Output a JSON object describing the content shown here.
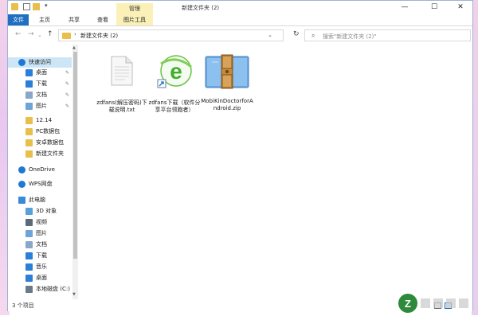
{
  "window": {
    "title": "新建文件夹 (2)"
  },
  "titlebar": {
    "minimize": "—",
    "maximize": "☐",
    "close": "✕",
    "quick_access_arrow": "▾"
  },
  "ribbon": {
    "manage_label": "管理",
    "tabs": [
      "文件",
      "主页",
      "共享",
      "查看",
      "图片工具"
    ]
  },
  "address": {
    "separator": "›",
    "path": "新建文件夹 (2)",
    "search_placeholder": "搜索\"新建文件夹 (2)\""
  },
  "nav_pane": {
    "items": [
      {
        "label": "快速访问",
        "icon": "star-icon",
        "color": "#1e78d4"
      },
      {
        "label": "桌面",
        "icon": "desktop-icon",
        "color": "#2b7fd8",
        "pinned": true
      },
      {
        "label": "下载",
        "icon": "download-icon",
        "color": "#2b7fd8",
        "pinned": true
      },
      {
        "label": "文档",
        "icon": "document-icon",
        "color": "#8aa6c8",
        "pinned": true
      },
      {
        "label": "图片",
        "icon": "picture-icon",
        "color": "#6ea4d8",
        "pinned": true
      },
      {
        "label": "12.14",
        "icon": "folder-icon",
        "color": "#e8bf4a"
      },
      {
        "label": "PC数据包",
        "icon": "folder-icon",
        "color": "#e8bf4a"
      },
      {
        "label": "安卓数据包",
        "icon": "folder-icon",
        "color": "#e8bf4a"
      },
      {
        "label": "新建文件夹",
        "icon": "folder-icon",
        "color": "#e8bf4a"
      },
      {
        "label": "OneDrive",
        "icon": "cloud-icon",
        "color": "#1e78d4"
      },
      {
        "label": "WPS网盘",
        "icon": "cloud-icon",
        "color": "#1e78d4"
      },
      {
        "label": "此电脑",
        "icon": "computer-icon",
        "color": "#3b8ad8"
      },
      {
        "label": "3D 对象",
        "icon": "cube-icon",
        "color": "#5aa0d8"
      },
      {
        "label": "视频",
        "icon": "video-icon",
        "color": "#5a6a7a"
      },
      {
        "label": "图片",
        "icon": "picture-icon",
        "color": "#6ea4d8"
      },
      {
        "label": "文档",
        "icon": "document-icon",
        "color": "#8aa6c8"
      },
      {
        "label": "下载",
        "icon": "download-icon",
        "color": "#2b7fd8"
      },
      {
        "label": "音乐",
        "icon": "music-icon",
        "color": "#2b7fd8"
      },
      {
        "label": "桌面",
        "icon": "desktop-icon",
        "color": "#2b7fd8"
      },
      {
        "label": "本地磁盘 (C:)",
        "icon": "drive-icon",
        "color": "#6a7a8a"
      }
    ]
  },
  "files": [
    {
      "name": "zdfans(解压密码)下载说明.txt",
      "icon": "text-file-icon"
    },
    {
      "name": "zdfans下载（软件分享平台领跑者）",
      "icon": "shortcut-ie-icon"
    },
    {
      "name": "MobiKinDoctorforAndroid.zip",
      "icon": "winrar-archive-icon"
    }
  ],
  "status": {
    "item_count": "3 个项目"
  },
  "watermark": {
    "text": "Z"
  },
  "colors": {
    "accent": "#1e6fc1",
    "selection": "#cde6f7",
    "manage_tab": "#fbf1b8"
  }
}
